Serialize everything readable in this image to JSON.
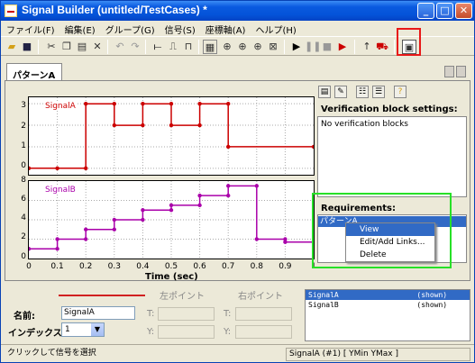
{
  "window": {
    "title": "Signal Builder (untitled/TestCases) *"
  },
  "menu": [
    "ファイル(F)",
    "編集(E)",
    "グループ(G)",
    "信号(S)",
    "座標軸(A)",
    "ヘルプ(H)"
  ],
  "tab": {
    "label": "パターンA"
  },
  "plot1": {
    "legend": "SignalA",
    "yticks": [
      "3",
      "2",
      "1",
      "0"
    ]
  },
  "plot2": {
    "legend": "SignalB",
    "yticks": [
      "8",
      "6",
      "4",
      "2",
      "0"
    ]
  },
  "xaxis": {
    "ticks": [
      "0",
      "0.1",
      "0.2",
      "0.3",
      "0.4",
      "0.5",
      "0.6",
      "0.7",
      "0.8",
      "0.9",
      "1"
    ],
    "label": "Time (sec)"
  },
  "chart_data": [
    {
      "type": "line",
      "series": [
        {
          "name": "SignalA",
          "x": [
            0,
            0.1,
            0.2,
            0.2,
            0.3,
            0.3,
            0.4,
            0.4,
            0.5,
            0.5,
            0.6,
            0.6,
            0.7,
            0.7,
            1.0
          ],
          "y": [
            0,
            0,
            0,
            3,
            3,
            2,
            2,
            3,
            3,
            2,
            2,
            3,
            3,
            1,
            1
          ]
        }
      ],
      "xlim": [
        0,
        1
      ],
      "ylim": [
        -0.3,
        3.3
      ],
      "color": "#cc0000"
    },
    {
      "type": "line",
      "series": [
        {
          "name": "SignalB",
          "x": [
            0,
            0.1,
            0.1,
            0.2,
            0.2,
            0.3,
            0.3,
            0.4,
            0.4,
            0.5,
            0.5,
            0.6,
            0.6,
            0.7,
            0.7,
            0.8,
            0.8,
            0.9,
            0.9,
            1.0
          ],
          "y": [
            1,
            1,
            2,
            2,
            3,
            3,
            4,
            4,
            5,
            5,
            5.5,
            5.5,
            6.5,
            6.5,
            7.5,
            7.5,
            2,
            2,
            1.7,
            1.7
          ]
        }
      ],
      "xlim": [
        0,
        1
      ],
      "ylim": [
        0,
        8
      ],
      "color": "#aa00aa"
    }
  ],
  "right_pane": {
    "verification_label": "Verification block settings:",
    "verification_text": "No verification blocks",
    "requirements_label": "Requirements:",
    "requirements_item": "パターンA"
  },
  "context_menu": [
    "View",
    "Edit/Add Links...",
    "Delete"
  ],
  "bottom": {
    "left_point": "左ポイント",
    "right_point": "右ポイント",
    "name_label": "名前:",
    "name_value": "SignalA",
    "index_label": "インデックス:",
    "index_value": "1",
    "t_label": "T:",
    "y_label": "Y:"
  },
  "signal_list": [
    {
      "text": "SignalA                  (shown)"
    },
    {
      "text": "SignalB                  (shown)"
    }
  ],
  "status": {
    "left": "クリックして信号を選択",
    "right": "SignalA (#1)  [ YMin YMax ]"
  }
}
